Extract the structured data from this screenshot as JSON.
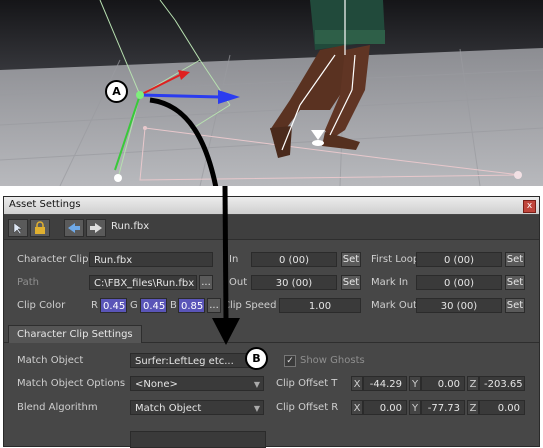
{
  "callouts": {
    "a": "A",
    "b": "B"
  },
  "panel": {
    "title": "Asset Settings",
    "close_glyph": "x",
    "toolbar_file": "Run.fbx",
    "tab": "Character Clip Settings"
  },
  "row1": {
    "label": "Character Clip",
    "value": "Run.fbx",
    "start_label": "In",
    "start_value": "0 (00)",
    "start_btn": "Set",
    "loop_label": "First Loop",
    "loop_value": "0 (00)",
    "loop_btn": "Set"
  },
  "row2": {
    "label": "Path",
    "value": "C:\\FBX_files\\Run.fbx",
    "browse": "...",
    "end_label": "Out",
    "end_value": "30 (00)",
    "end_btn": "Set",
    "markin_label": "Mark In",
    "markin_value": "0 (00)",
    "markin_btn": "Set"
  },
  "row3": {
    "label": "Clip Color",
    "r_label": "R",
    "r_value": "0.45",
    "g_label": "G",
    "g_value": "0.45",
    "b_label": "B",
    "b_value": "0.85",
    "picker": "...",
    "speed_label": "Clip Speed",
    "speed_value": "1.00",
    "markout_label": "Mark Out",
    "markout_value": "30 (00)",
    "markout_btn": "Set"
  },
  "settings": {
    "match_object_label": "Match Object",
    "match_object_value": "Surfer:LeftLeg etc...",
    "show_ghosts_label": "Show Ghosts",
    "show_ghosts_check": "✓",
    "match_options_label": "Match Object Options",
    "match_options_value": "<None>",
    "offset_t_label": "Clip Offset T",
    "offset_t": {
      "x_label": "X",
      "x": "-44.29",
      "y_label": "Y",
      "y": "0.00",
      "z_label": "Z",
      "z": "-203.65"
    },
    "blend_label": "Blend Algorithm",
    "blend_value": "Match Object",
    "offset_r_label": "Clip Offset R",
    "offset_r": {
      "x_label": "X",
      "x": "0.00",
      "y_label": "Y",
      "y": "-77.73",
      "z_label": "Z",
      "z": "0.00"
    }
  },
  "colors": {
    "rgb_highlight": "#5a55b8",
    "panel_bg": "#474747",
    "viewport_floor": "#a9aaae",
    "sky": "#1e1e22"
  },
  "icons": [
    "pointer-icon",
    "lock-icon",
    "arrow-left-icon",
    "arrow-right-icon"
  ]
}
